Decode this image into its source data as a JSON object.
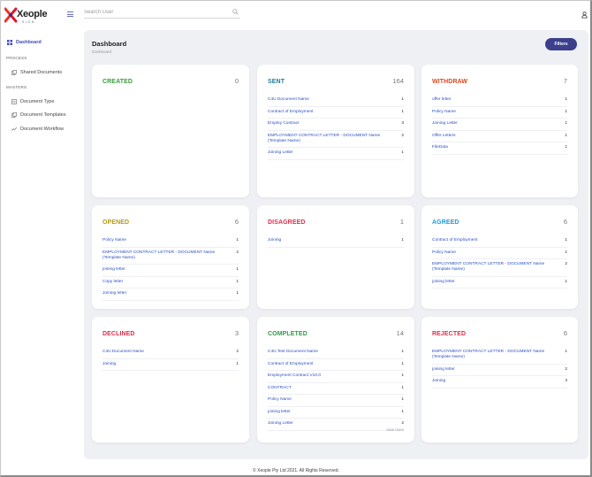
{
  "brand": {
    "name": "Xeople",
    "tagline": "SIGN"
  },
  "search": {
    "placeholder": "Search User"
  },
  "sidebar": {
    "dashboard": "Dashboard",
    "process_heading": "PROCESS",
    "shared_documents": "Shared Documents",
    "masters_heading": "MASTERS",
    "document_type": "Document Type",
    "document_templates": "Document Templates",
    "document_workflow": "Document Workflow"
  },
  "page": {
    "title": "Dashboard",
    "breadcrumb": "Dashboard",
    "filters_label": "Filters"
  },
  "colors": {
    "created": "#3a9a3a",
    "sent": "#1f7a9a",
    "withdraw": "#e0461c",
    "opened": "#b59a12",
    "disagreed": "#d9304b",
    "agreed": "#1f9ad6",
    "declined": "#d9304b",
    "completed": "#2e9a4a",
    "rejected": "#d9304b",
    "link": "#2a4fc4",
    "primary": "#3b3f8c"
  },
  "cards": [
    {
      "title": "CREATED",
      "count": "0",
      "items": []
    },
    {
      "title": "SENT",
      "count": "164",
      "items": [
        {
          "name": "C4U Document Name",
          "count": "1"
        },
        {
          "name": "Contract of Employment",
          "count": "1"
        },
        {
          "name": "Employ Contract",
          "count": "3"
        },
        {
          "name": "EMPLOYMENT CONTRACT LETTER - DOCUMENT Name (Template Name)",
          "count": "2"
        },
        {
          "name": "Joining Letter",
          "count": "1"
        }
      ]
    },
    {
      "title": "WITHDRAW",
      "count": "7",
      "items": [
        {
          "name": "offer letter",
          "count": "1"
        },
        {
          "name": "Policy Name",
          "count": "1"
        },
        {
          "name": "Joining Letter",
          "count": "1"
        },
        {
          "name": "Offer Letters",
          "count": "1"
        },
        {
          "name": " FileData",
          "count": "1"
        }
      ]
    },
    {
      "title": "OPENED",
      "count": "6",
      "items": [
        {
          "name": "Policy Name",
          "count": "1"
        },
        {
          "name": "EMPLOYMENT CONTRACT LETTER - DOCUMENT Name (Template Name)",
          "count": "2"
        },
        {
          "name": "joining letter",
          "count": "1"
        },
        {
          "name": " Copy letter",
          "count": "1"
        },
        {
          "name": "Joining letter",
          "count": "1"
        }
      ]
    },
    {
      "title": "DISAGREED",
      "count": "1",
      "items": [
        {
          "name": "Joining",
          "count": "1"
        }
      ]
    },
    {
      "title": "AGREED",
      "count": "6",
      "items": [
        {
          "name": "Contract of Employment",
          "count": "1"
        },
        {
          "name": "Policy Name",
          "count": "1"
        },
        {
          "name": "EMPLOYMENT CONTRACT LETTER - DOCUMENT Name (Template Name)",
          "count": "2"
        },
        {
          "name": "joining letter",
          "count": "1"
        }
      ]
    },
    {
      "title": "DECLINED",
      "count": "3",
      "items": [
        {
          "name": "C4U Document Name",
          "count": "2"
        },
        {
          "name": "Joining",
          "count": "1"
        }
      ]
    },
    {
      "title": "COMPLETED",
      "count": "14",
      "items": [
        {
          "name": "C4U Test Document Name",
          "count": "1"
        },
        {
          "name": "Contract of Employment",
          "count": "1"
        },
        {
          "name": "Employment Contract V10.0",
          "count": "1"
        },
        {
          "name": "CONTRACT",
          "count": "1"
        },
        {
          "name": "Policy Name",
          "count": "1"
        },
        {
          "name": "joining letter",
          "count": "1"
        },
        {
          "name": "Joining Letter",
          "count": "2"
        }
      ],
      "view_more": "view more"
    },
    {
      "title": "REJECTED",
      "count": "6",
      "items": [
        {
          "name": "EMPLOYMENT CONTRACT LETTER - DOCUMENT Name (Template Name)",
          "count": "1"
        },
        {
          "name": "joining letter",
          "count": "2"
        },
        {
          "name": "Joining",
          "count": "3"
        }
      ]
    }
  ],
  "footer": "© Xeople Pty Ltd 2021. All Rights Reserved."
}
